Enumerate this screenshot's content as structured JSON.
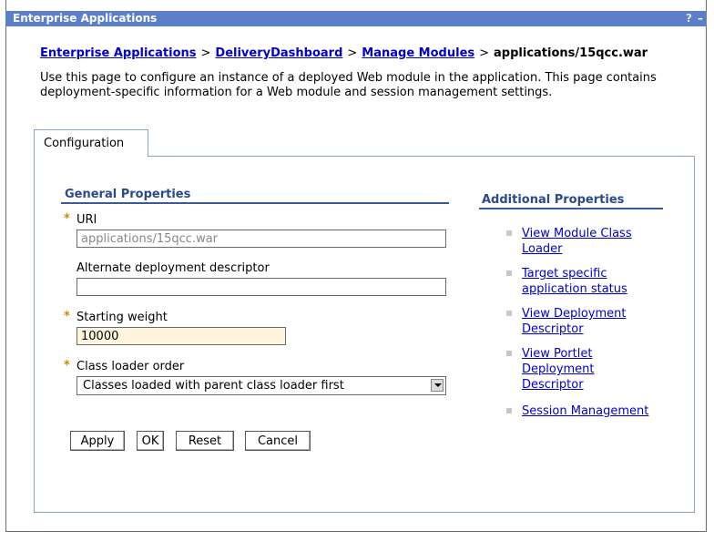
{
  "window": {
    "title": "Enterprise Applications",
    "help_icon": "?",
    "minimize_icon": "–"
  },
  "breadcrumb": {
    "items": [
      "Enterprise Applications",
      "DeliveryDashboard",
      "Manage Modules"
    ],
    "separator": ">",
    "current": "applications/15qcc.war"
  },
  "description": "Use this page to configure an instance of a deployed Web module in the application. This page contains deployment-specific information for a Web module and session management settings.",
  "tabs": [
    {
      "label": "Configuration",
      "active": true
    }
  ],
  "general": {
    "heading": "General Properties",
    "required_marker": "*",
    "uri": {
      "label": "URI",
      "value": "applications/15qcc.war"
    },
    "alt_dd": {
      "label": "Alternate deployment descriptor",
      "value": ""
    },
    "starting_weight": {
      "label": "Starting weight",
      "value": "10000"
    },
    "class_loader": {
      "label": "Class loader order",
      "value": "Classes loaded with parent class loader first"
    }
  },
  "buttons": {
    "apply": "Apply",
    "ok": "OK",
    "reset": "Reset",
    "cancel": "Cancel"
  },
  "additional": {
    "heading": "Additional Properties",
    "links": [
      "View Module Class Loader",
      "Target specific application status",
      "View Deployment Descriptor",
      "View Portlet Deployment Descriptor",
      "Session Management"
    ]
  },
  "colors": {
    "titlebar": "#5b7fc8",
    "link": "#0000cc",
    "required": "#c88a00",
    "highlight_field": "#fff5dc"
  }
}
